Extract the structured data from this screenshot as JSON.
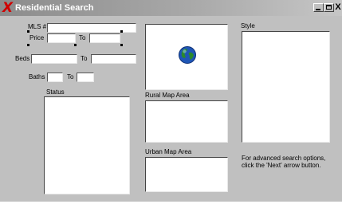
{
  "window": {
    "title": "Residential Search",
    "minimize_label": "",
    "maximize_label": "",
    "close_label": "X"
  },
  "form": {
    "mls_label": "MLS #",
    "price_label": "Price",
    "to_label_price": "To",
    "beds_label": "Beds",
    "to_label_beds": "To",
    "baths_label": "Baths",
    "to_label_baths": "To",
    "status_label": "Status",
    "rural_map_label": "Rural Map Area",
    "urban_map_label": "Urban Map Area",
    "style_label": "Style",
    "advanced_note": "For advanced search options, click the 'Next' arrow button."
  },
  "values": {
    "mls": "",
    "price_from": "",
    "price_to": "",
    "beds_from": "",
    "beds_to": "",
    "baths_from": "",
    "baths_to": ""
  },
  "icons": {
    "app": "red-x-icon",
    "globe": "globe-icon"
  }
}
